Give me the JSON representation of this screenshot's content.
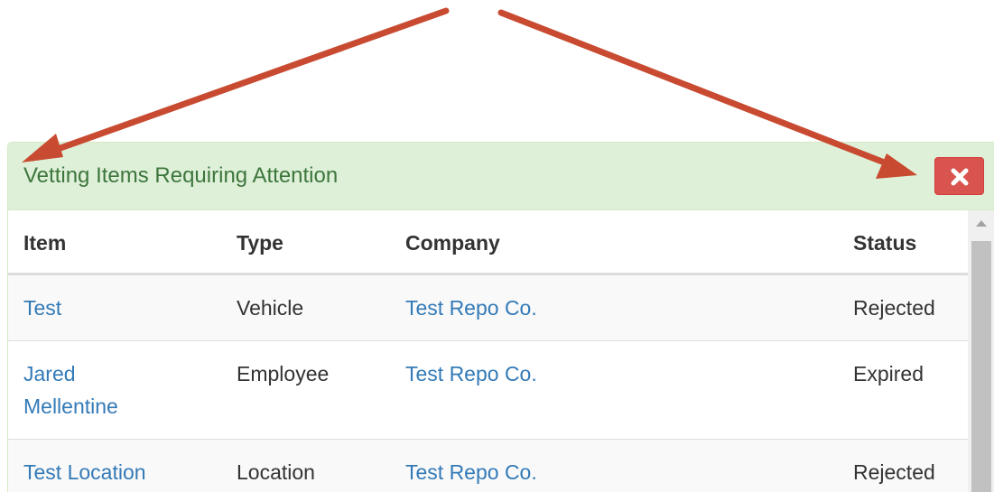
{
  "panel": {
    "title": "Vetting Items Requiring Attention",
    "close_icon": "times-icon"
  },
  "table": {
    "headers": {
      "item": "Item",
      "type": "Type",
      "company": "Company",
      "status": "Status"
    },
    "rows": [
      {
        "item": "Test",
        "type": "Vehicle",
        "company": "Test Repo Co.",
        "status": "Rejected"
      },
      {
        "item": "Jared Mellentine",
        "type": "Employee",
        "company": "Test Repo Co.",
        "status": "Expired"
      },
      {
        "item": "Test Location",
        "type": "Location",
        "company": "Test Repo Co.",
        "status": "Rejected"
      }
    ]
  },
  "annotations": {
    "arrow_color": "#c84b31"
  },
  "colors": {
    "panel_heading_bg": "#dff0d8",
    "panel_title": "#3c763d",
    "link": "#337ab7",
    "danger": "#d9534f"
  }
}
